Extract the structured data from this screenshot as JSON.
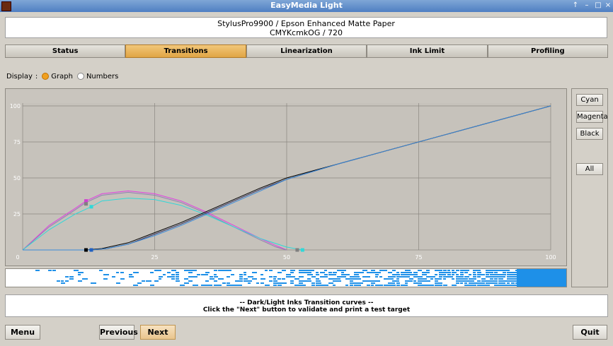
{
  "window": {
    "title": "EasyMedia Light",
    "controls": [
      "↑",
      "–",
      "□",
      "×"
    ]
  },
  "header": {
    "line1": "StylusPro9900 / Epson Enhanced Matte Paper",
    "line2": "CMYKcmkOG / 720"
  },
  "tabs": [
    {
      "label": "Status",
      "active": false
    },
    {
      "label": "Transitions",
      "active": true
    },
    {
      "label": "Linearization",
      "active": false
    },
    {
      "label": "Ink Limit",
      "active": false
    },
    {
      "label": "Profiling",
      "active": false
    }
  ],
  "display": {
    "label": "Display",
    "sep": ":",
    "options": [
      {
        "label": "Graph",
        "selected": true
      },
      {
        "label": "Numbers",
        "selected": false
      }
    ]
  },
  "chart_data": {
    "type": "line",
    "xlim": [
      0,
      100
    ],
    "ylim": [
      0,
      100
    ],
    "x_ticks": [
      0,
      25,
      50,
      75,
      100
    ],
    "y_ticks": [
      0,
      25,
      50,
      75,
      100
    ],
    "grid": true,
    "series": [
      {
        "color": "#e040e0",
        "x": [
          0,
          5,
          10,
          12,
          15,
          20,
          25,
          30,
          35,
          40,
          45,
          48,
          50
        ],
        "y": [
          0,
          17,
          29,
          34,
          39,
          41,
          39,
          34,
          26,
          17,
          8,
          3,
          0
        ]
      },
      {
        "color": "#9080b0",
        "x": [
          0,
          5,
          10,
          12,
          15,
          20,
          25,
          30,
          35,
          40,
          45,
          48,
          50
        ],
        "y": [
          0,
          16,
          28,
          33,
          38,
          40,
          38,
          33,
          25,
          16,
          7,
          2,
          0
        ]
      },
      {
        "color": "#30d8d8",
        "x": [
          0,
          5,
          10,
          13,
          15,
          20,
          25,
          30,
          35,
          40,
          45,
          50,
          53
        ],
        "y": [
          0,
          14,
          25,
          30,
          34,
          36,
          35,
          31,
          24,
          16,
          8,
          2,
          0
        ]
      },
      {
        "color": "#000000",
        "x": [
          0,
          12,
          15,
          20,
          25,
          30,
          35,
          40,
          45,
          50,
          60,
          70,
          80,
          90,
          100
        ],
        "y": [
          0,
          0,
          1,
          5,
          12,
          19,
          27,
          35,
          43,
          50,
          60,
          70,
          80,
          90,
          100
        ]
      },
      {
        "color": "#303060",
        "x": [
          0,
          13,
          16,
          20,
          25,
          30,
          35,
          40,
          45,
          50,
          60,
          70,
          80,
          90,
          100
        ],
        "y": [
          0,
          0,
          1,
          4,
          11,
          18,
          26,
          34,
          42,
          49,
          60,
          70,
          80,
          90,
          100
        ]
      },
      {
        "color": "#3a8ad8",
        "x": [
          0,
          13,
          16,
          20,
          25,
          30,
          35,
          40,
          45,
          50,
          60,
          70,
          80,
          90,
          100
        ],
        "y": [
          0,
          0,
          1,
          4,
          10,
          17,
          25,
          33,
          41,
          49,
          60,
          70,
          80,
          90,
          100
        ]
      }
    ],
    "markers": [
      {
        "x": 12,
        "y": 34,
        "color": "#d040d0"
      },
      {
        "x": 12,
        "y": 32,
        "color": "#808080"
      },
      {
        "x": 13,
        "y": 30,
        "color": "#30d8d8"
      },
      {
        "x": 12,
        "y": 0,
        "color": "#000000"
      },
      {
        "x": 13,
        "y": 0,
        "color": "#2060c0"
      },
      {
        "x": 52,
        "y": 0,
        "color": "#808080"
      },
      {
        "x": 53,
        "y": 0,
        "color": "#30d8d8"
      }
    ]
  },
  "side_buttons": [
    {
      "label": "Cyan",
      "name": "cyan-button"
    },
    {
      "label": "Magenta",
      "name": "magenta-button"
    },
    {
      "label": "Black",
      "name": "black-button"
    },
    {
      "label": "All",
      "name": "all-button"
    }
  ],
  "message": {
    "line1": "-- Dark/Light Inks Transition curves --",
    "line2": "Click the \"Next\" button to validate and print a test target"
  },
  "buttons": {
    "menu": "Menu",
    "previous": "Previous",
    "next": "Next",
    "quit": "Quit"
  },
  "colors": {
    "accent": "#e0a545",
    "gradient_end": "#1e90e8"
  }
}
